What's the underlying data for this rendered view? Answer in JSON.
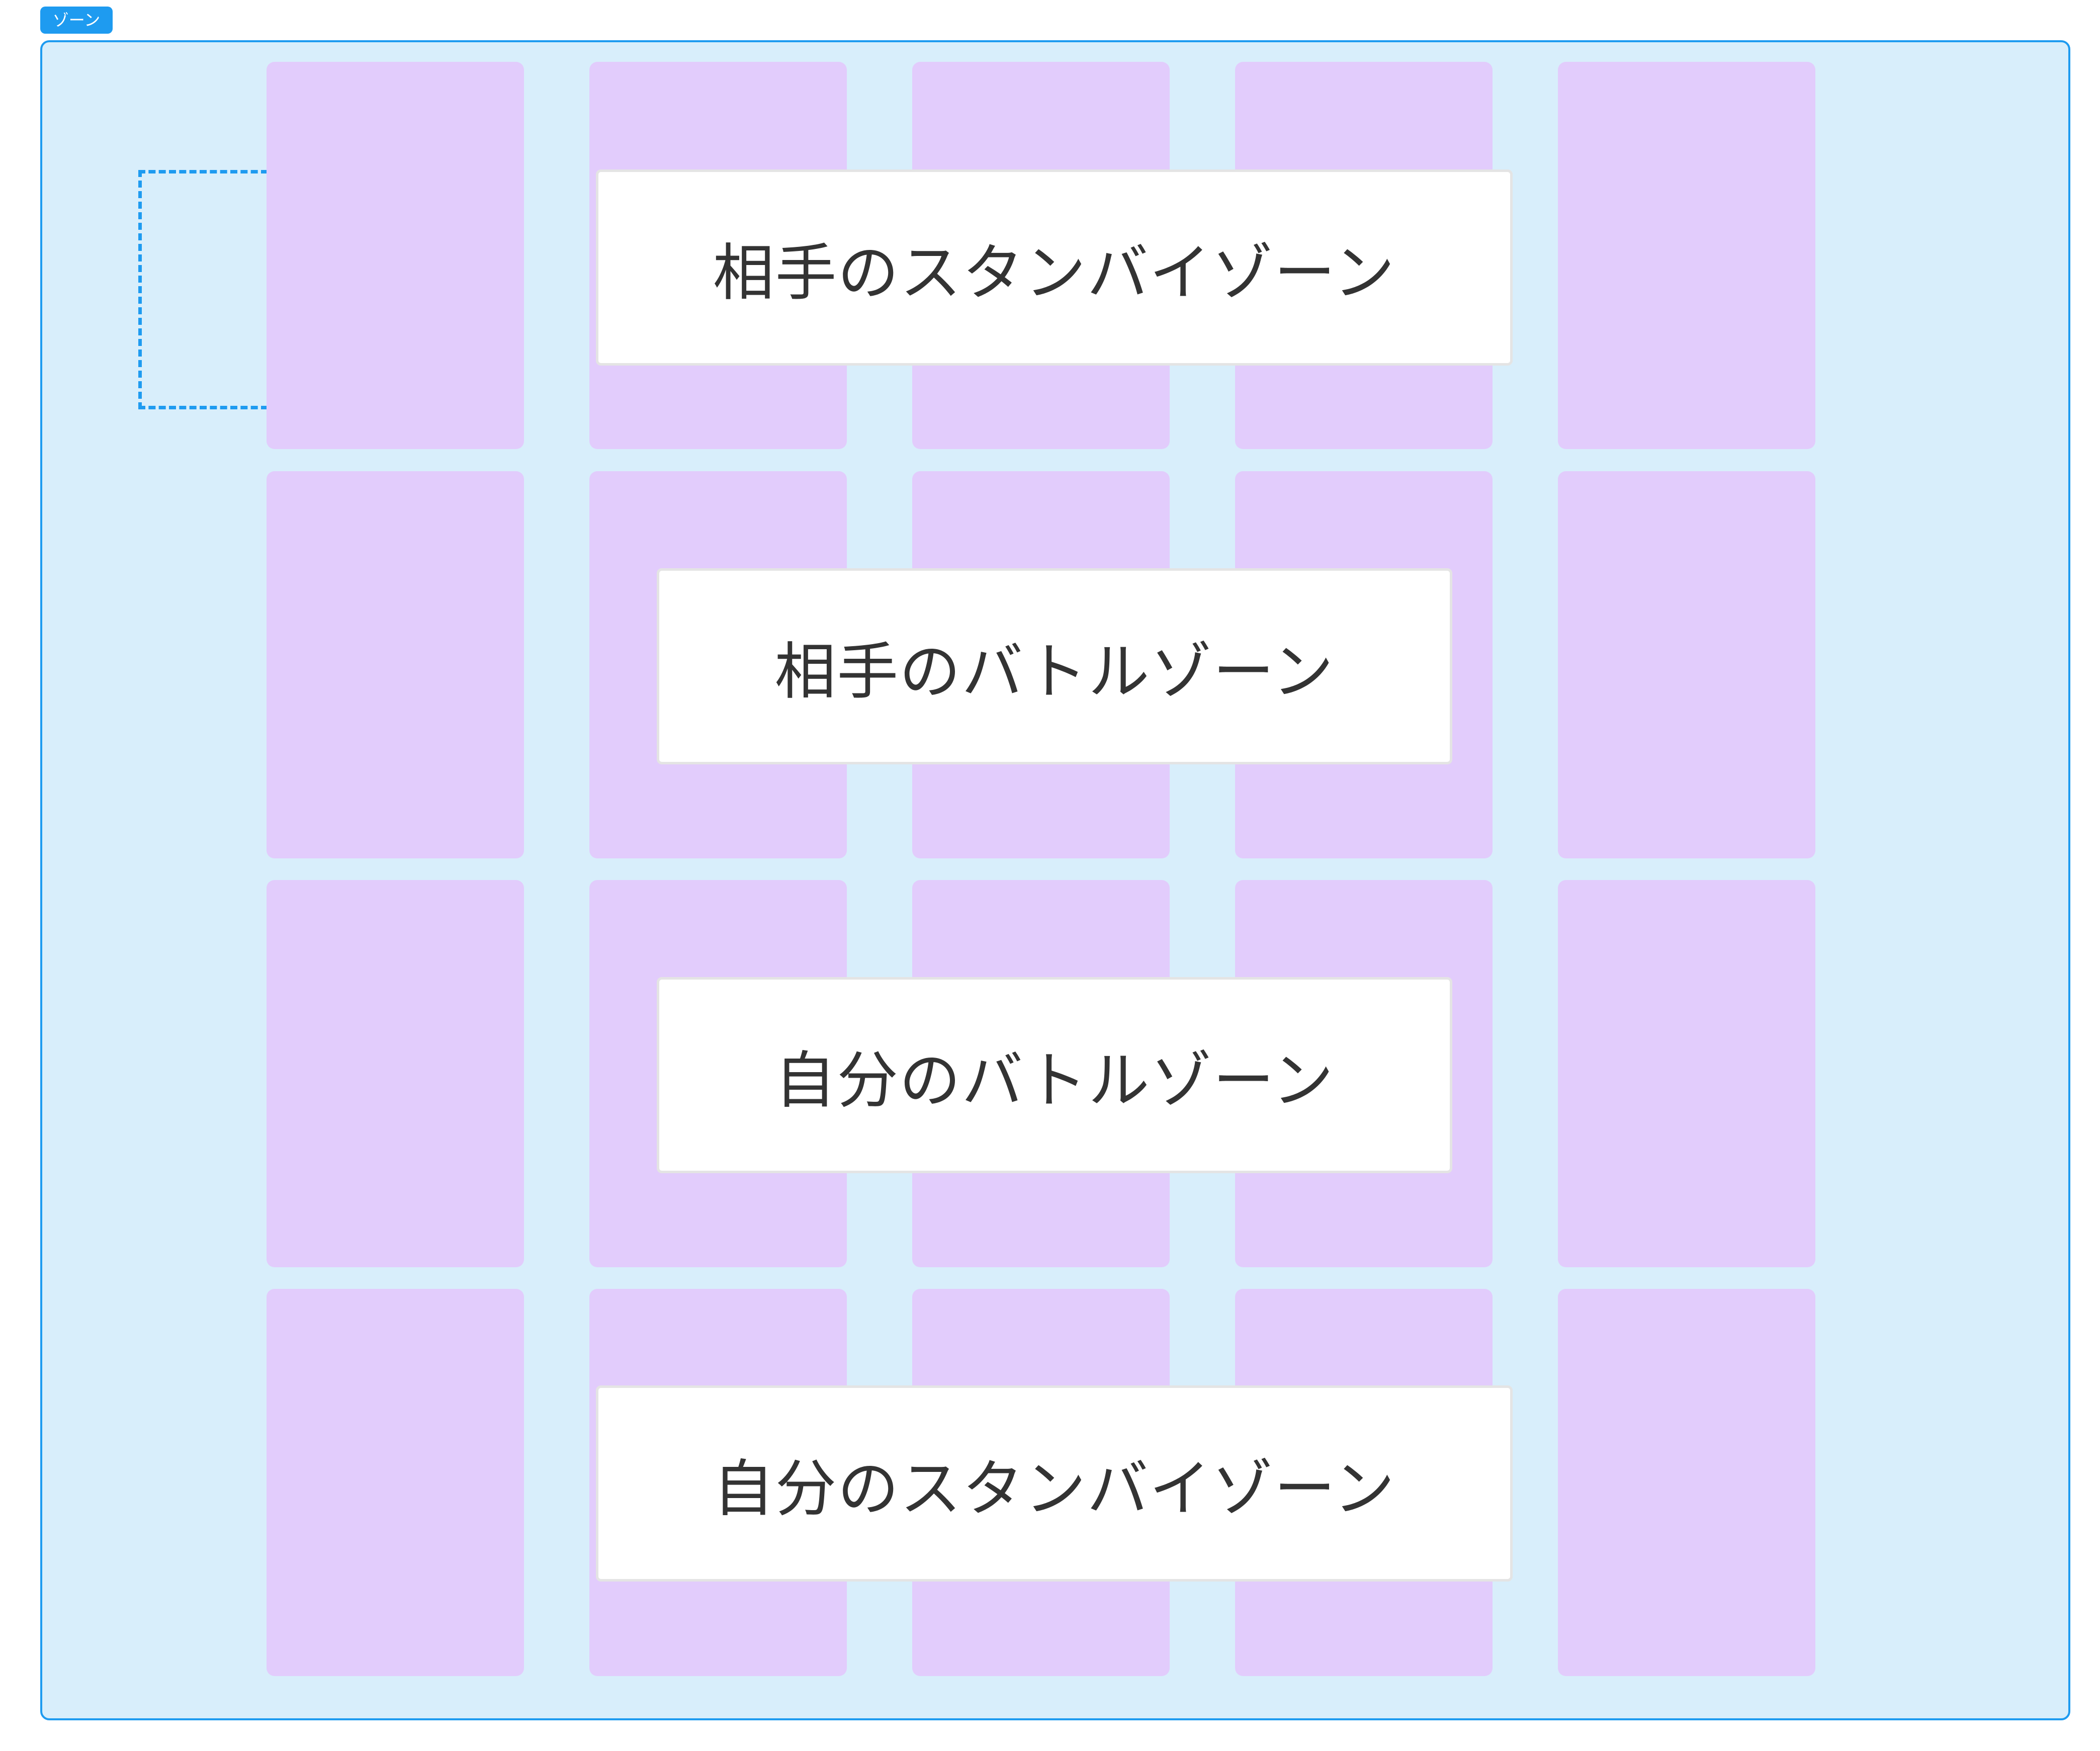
{
  "tag": {
    "label": "ゾーン"
  },
  "colors": {
    "accent": "#1E9BF0",
    "zone_background": "#D8EEFB",
    "card_slot": "#E2CCFC",
    "label_text": "#333333"
  },
  "grid": {
    "rows": 4,
    "columns": 5
  },
  "zones": [
    {
      "label": "相手のスタンバイゾーン"
    },
    {
      "label": "相手のバトルゾーン"
    },
    {
      "label": "自分のバトルゾーン"
    },
    {
      "label": "自分のスタンバイゾーン"
    }
  ]
}
